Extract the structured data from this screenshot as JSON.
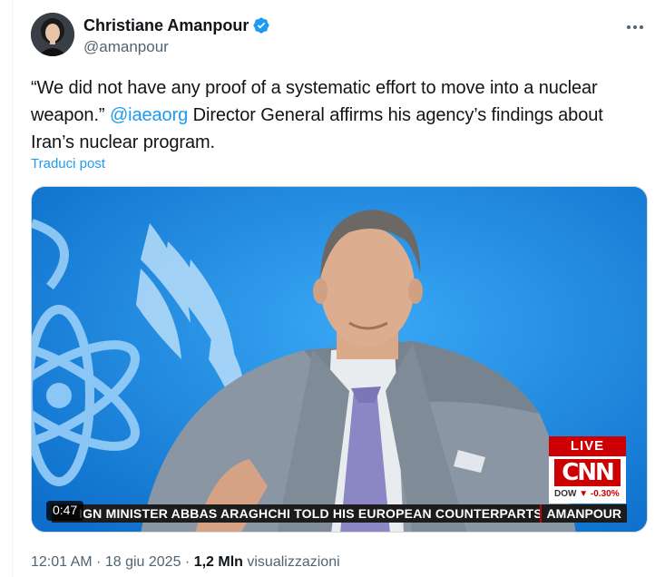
{
  "author": {
    "name": "Christiane Amanpour",
    "handle": "@amanpour",
    "verified": true,
    "verified_color": "#1d9bf0"
  },
  "tweet": {
    "text_before": "“We did not have any proof of a systematic effort to move into a nuclear weapon.” ",
    "mention": "@iaeaorg",
    "text_after": " Director General affirms his agency’s findings about Iran’s nuclear program.",
    "translate_label": "Traduci post"
  },
  "media": {
    "duration": "0:47",
    "ticker": "IGN MINISTER ABBAS ARAGHCHI TOLD HIS EUROPEAN COUNTERPARTS THAT WH",
    "show_name": "AMANPOUR",
    "live_label": "LIVE",
    "network": "CNN",
    "dow_label": "DOW",
    "dow_change": "▼ -0.30%"
  },
  "meta": {
    "time": "12:01 AM",
    "separator": " · ",
    "date": "18 giu 2025",
    "views_count": "1,2 Mln",
    "views_label": "visualizzazioni"
  },
  "icons": {
    "more": "more-horizontal-icon",
    "verified": "verified-badge-icon"
  },
  "colors": {
    "accent": "#1d9bf0",
    "text": "#0f1419",
    "secondary": "#536471",
    "cnn_red": "#cc0000"
  }
}
